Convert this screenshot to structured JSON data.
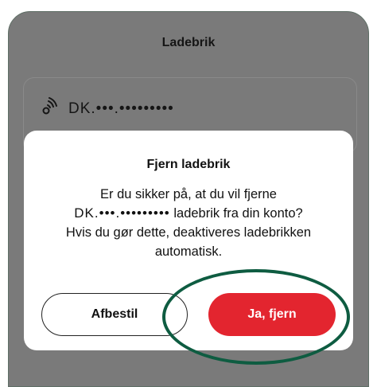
{
  "sheet": {
    "title": "Ladebrik",
    "card_number": "DK.•••.•••••••••"
  },
  "dialog": {
    "title": "Fjern ladebrik",
    "body_line1": "Er du sikker på, at du vil fjerne",
    "body_line2_card": "DK.•••.•••••••••",
    "body_line2_rest": " ladebrik fra din konto?",
    "body_line3": "Hvis du gør dette, deaktiveres ladebrikken",
    "body_line4": "automatisk.",
    "cancel_label": "Afbestil",
    "confirm_label": "Ja, fjern"
  },
  "colors": {
    "confirm": "#e3252f",
    "highlight": "#0e5c41",
    "overlay": "#7a7a7a"
  }
}
